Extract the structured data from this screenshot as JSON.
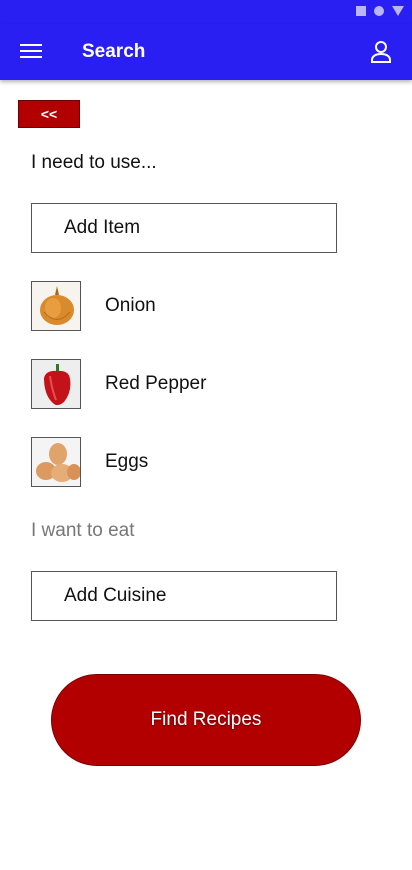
{
  "app_bar": {
    "title": "Search",
    "menu_icon": "menu-icon",
    "profile_icon": "profile-icon",
    "color": "#2a1ff2"
  },
  "back_button": {
    "label": "<<"
  },
  "ingredients_section": {
    "label": "I need to use...",
    "add_item_label": "Add Item",
    "items": [
      {
        "name": "Onion",
        "icon": "onion-icon"
      },
      {
        "name": "Red Pepper",
        "icon": "red-pepper-icon"
      },
      {
        "name": "Eggs",
        "icon": "eggs-icon"
      }
    ]
  },
  "cuisine_section": {
    "label": "I want to eat",
    "add_cuisine_label": "Add Cuisine"
  },
  "find_button": {
    "label": "Find Recipes",
    "color": "#b20000"
  }
}
